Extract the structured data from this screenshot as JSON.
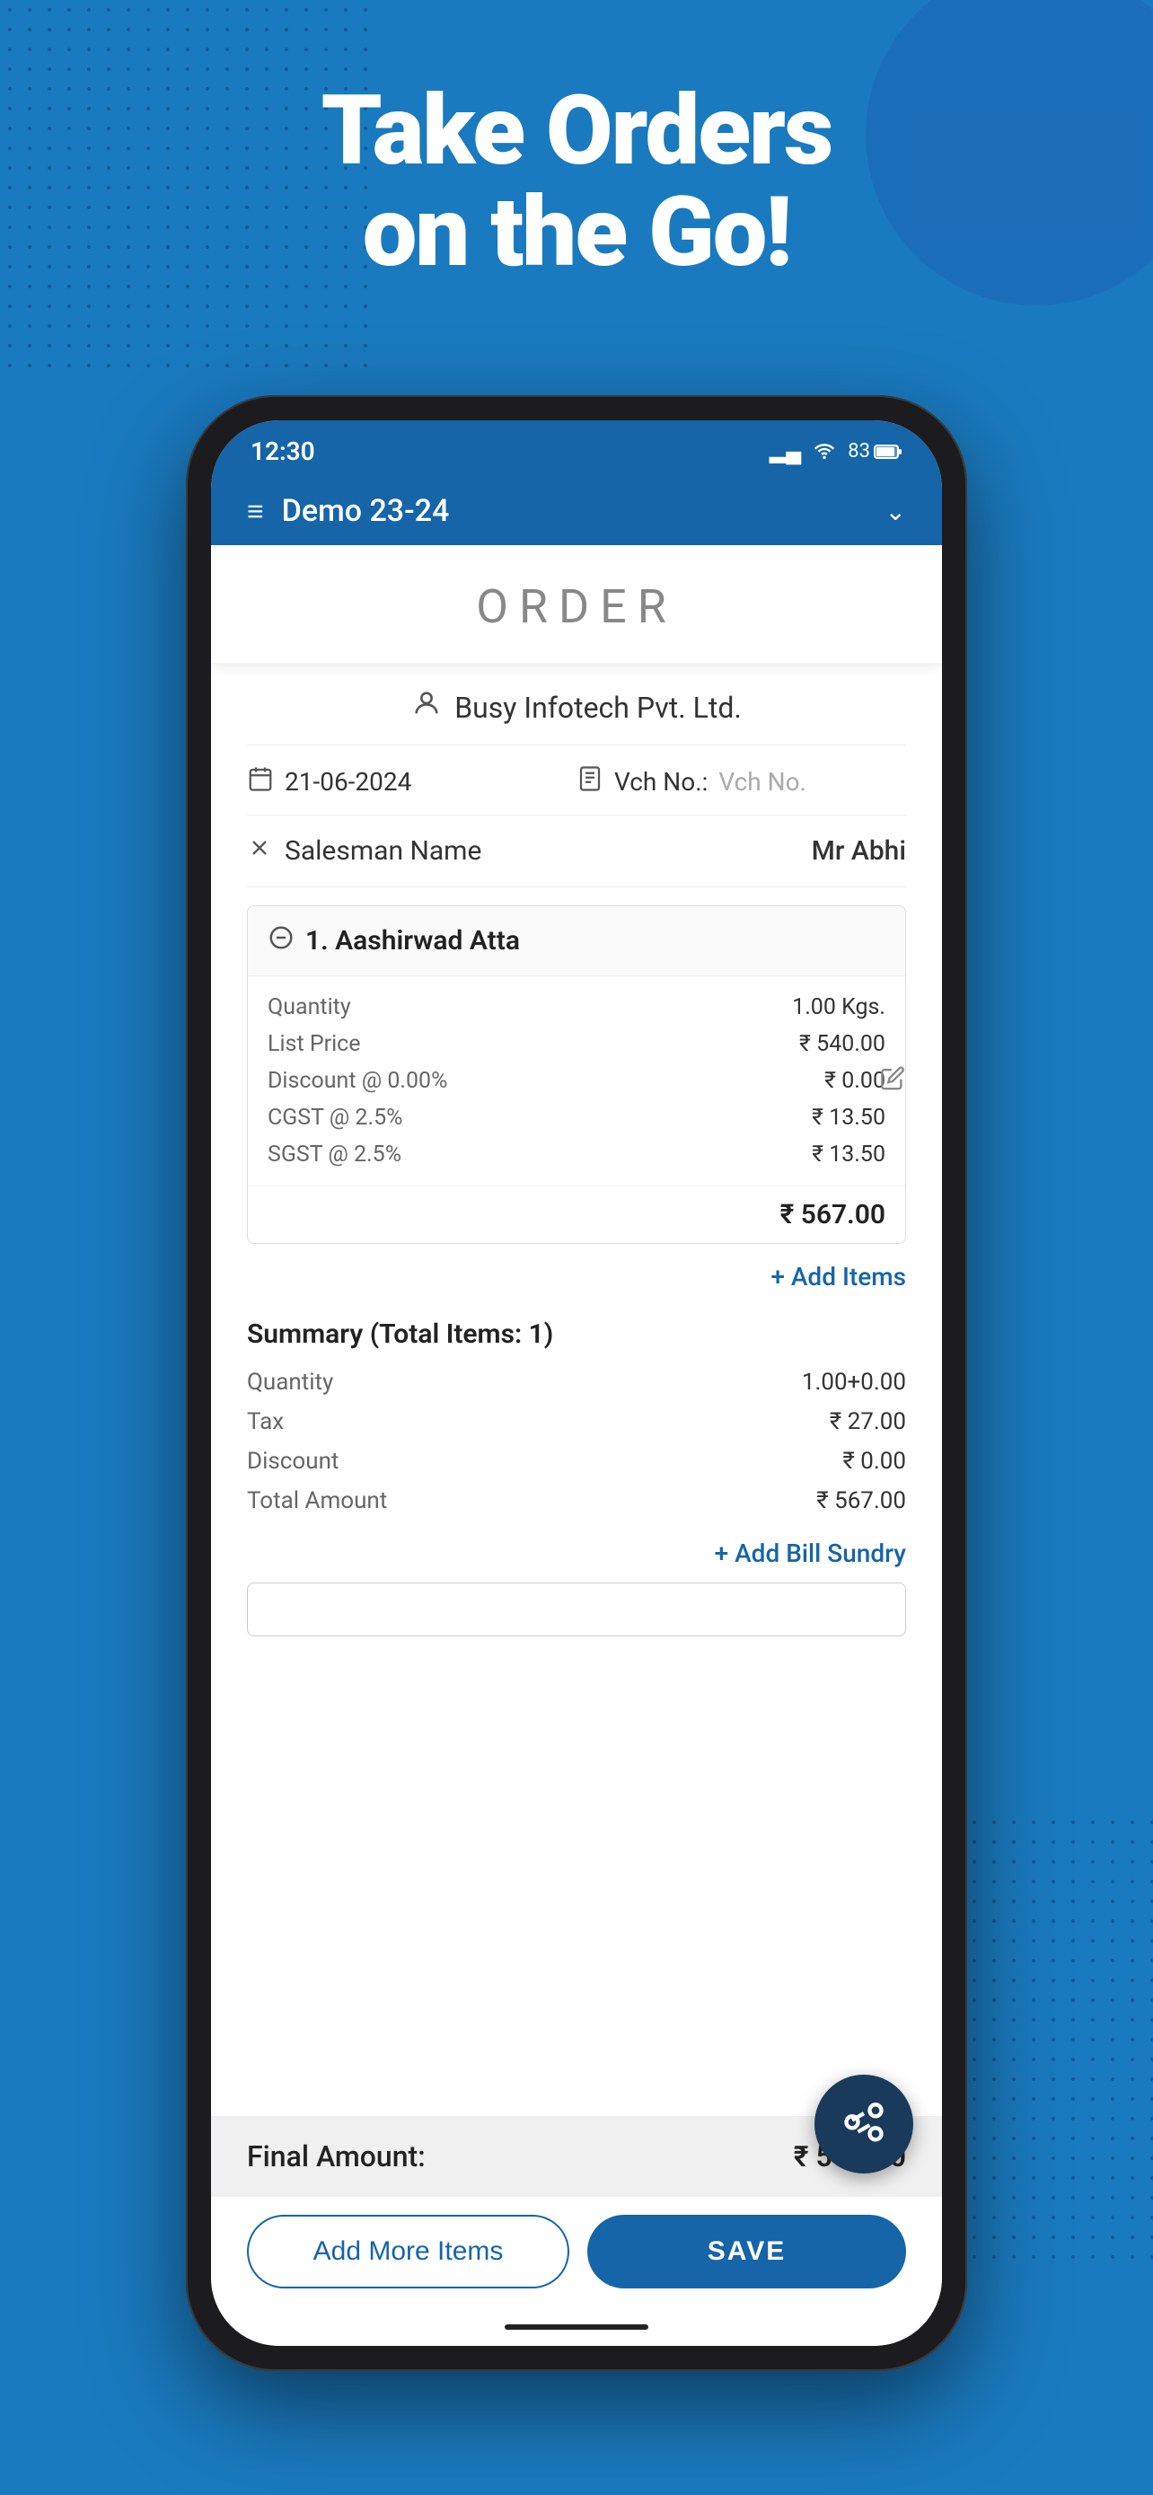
{
  "background": {
    "color": "#1a7abf"
  },
  "hero": {
    "line1": "Take Orders",
    "line2": "on the Go!"
  },
  "statusBar": {
    "time": "12:30",
    "signal": "▂▃",
    "wifi": "WiFi",
    "battery": "83"
  },
  "header": {
    "title": "Demo 23-24",
    "menuIcon": "≡",
    "chevron": "⌄"
  },
  "orderTitle": "ORDER",
  "party": {
    "icon": "👤",
    "name": "Busy Infotech Pvt. Ltd."
  },
  "date": {
    "icon": "📅",
    "value": "21-06-2024"
  },
  "voucher": {
    "icon": "🧾",
    "label": "Vch No.:",
    "placeholder": "Vch No."
  },
  "salesman": {
    "icon": "✖",
    "label": "Salesman Name",
    "value": "Mr Abhi"
  },
  "item": {
    "number": "1.",
    "name": "Aashirwad Atta",
    "details": [
      {
        "label": "Quantity",
        "value": "1.00 Kgs."
      },
      {
        "label": "List Price",
        "value": "₹ 540.00"
      },
      {
        "label": "Discount @ 0.00%",
        "value": "₹ 0.00"
      },
      {
        "label": "CGST @ 2.5%",
        "value": "₹ 13.50"
      },
      {
        "label": "SGST @ 2.5%",
        "value": "₹ 13.50"
      }
    ],
    "total": "₹ 567.00"
  },
  "addItemsLabel": "+ Add Items",
  "summary": {
    "title": "Summary (Total Items: 1)",
    "rows": [
      {
        "label": "Quantity",
        "value": "1.00+0.00"
      },
      {
        "label": "Tax",
        "value": "₹ 27.00"
      },
      {
        "label": "Discount",
        "value": "₹ 0.00"
      },
      {
        "label": "Total Amount",
        "value": "₹ 567.00"
      }
    ]
  },
  "addBillSundryLabel": "+ Add Bill Sundry",
  "finalAmount": {
    "label": "Final Amount:",
    "value": "₹ 567.00"
  },
  "buttons": {
    "addMore": "Add More Items",
    "save": "SAVE"
  }
}
